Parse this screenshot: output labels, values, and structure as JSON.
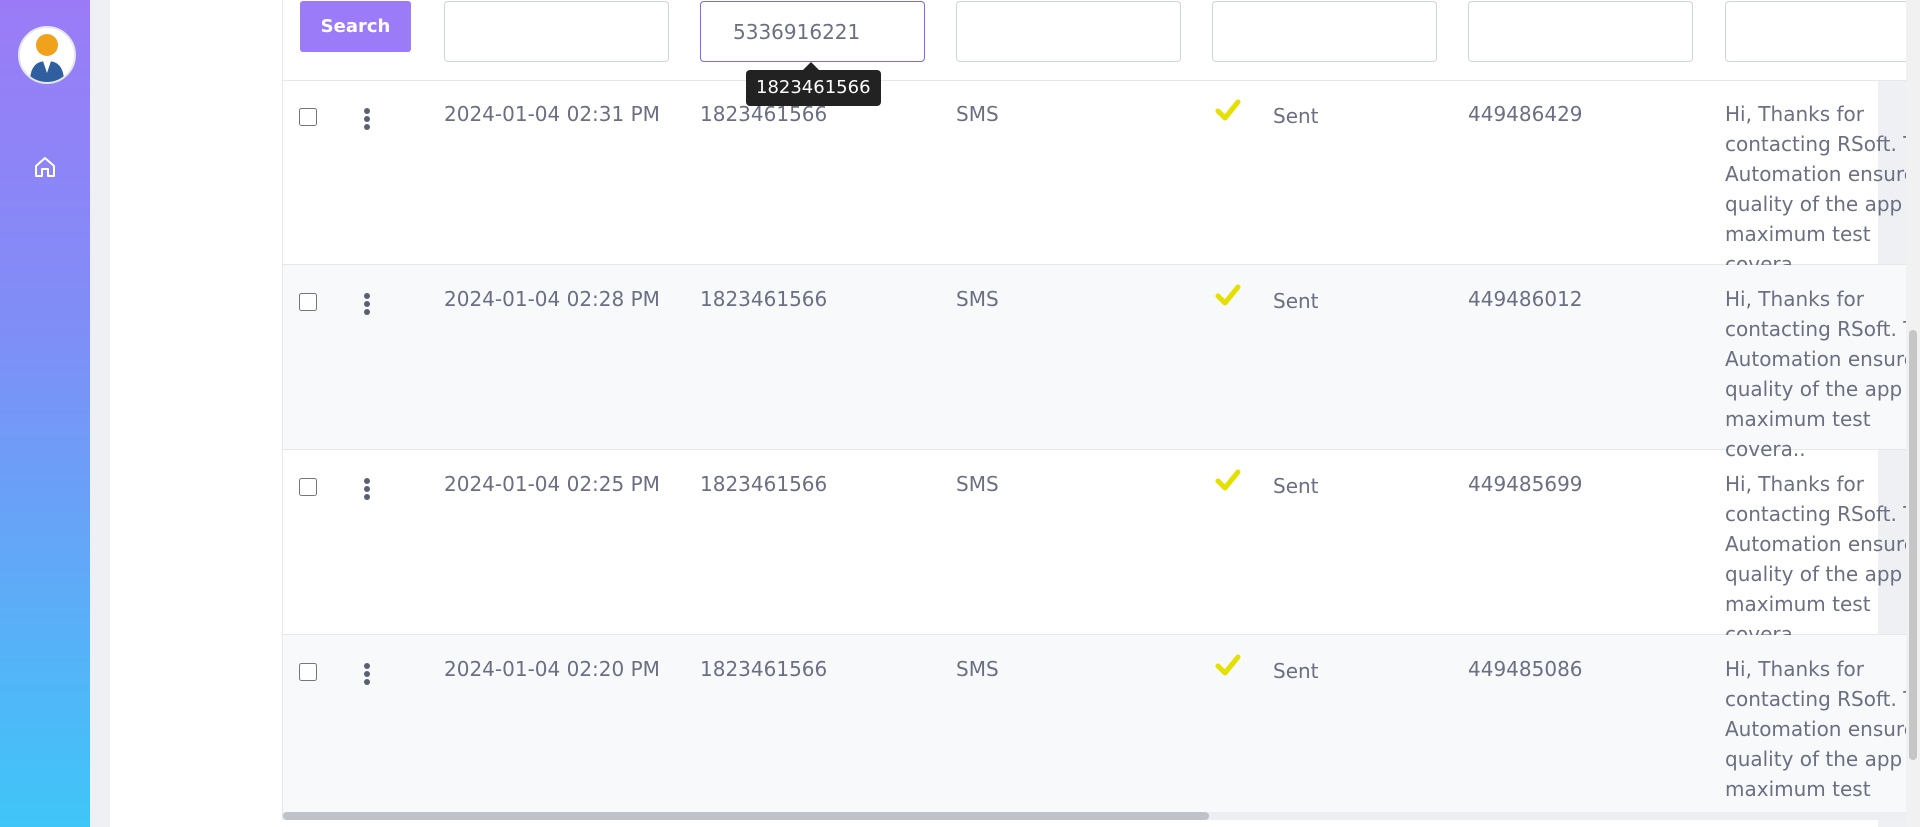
{
  "toolbar": {
    "search_label": "Search"
  },
  "filters": [
    {
      "value": ""
    },
    {
      "value": "5336916221"
    },
    {
      "value": ""
    },
    {
      "value": ""
    },
    {
      "value": ""
    },
    {
      "value": ""
    }
  ],
  "tooltip": "1823461566",
  "rows": [
    {
      "date": "2024-01-04 02:31 PM",
      "phone": "1823461566",
      "channel": "SMS",
      "status": "Sent",
      "id": "449486429",
      "message": "Hi, Thanks for contacting RSoft. Test Automation ensures quality of the app and maximum test covera.."
    },
    {
      "date": "2024-01-04 02:28 PM",
      "phone": "1823461566",
      "channel": "SMS",
      "status": "Sent",
      "id": "449486012",
      "message": "Hi, Thanks for contacting RSoft. Test Automation ensures quality of the app and maximum test covera.."
    },
    {
      "date": "2024-01-04 02:25 PM",
      "phone": "1823461566",
      "channel": "SMS",
      "status": "Sent",
      "id": "449485699",
      "message": "Hi, Thanks for contacting RSoft. Test Automation ensures quality of the app and maximum test covera.."
    },
    {
      "date": "2024-01-04 02:20 PM",
      "phone": "1823461566",
      "channel": "SMS",
      "status": "Sent",
      "id": "449485086",
      "message": "Hi, Thanks for contacting RSoft. Test Automation ensures quality of the app and maximum test covera.."
    }
  ],
  "colors": {
    "accent": "#9b7bf7",
    "sent_check": "#e4e000"
  },
  "icons": {
    "avatar": "user-avatar",
    "home": "home-icon",
    "menu": "more-vertical-icon",
    "status": "checkmark-icon"
  }
}
